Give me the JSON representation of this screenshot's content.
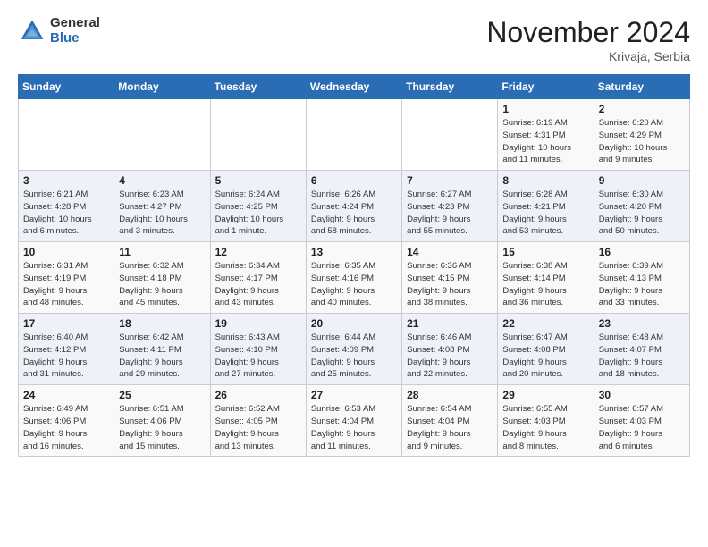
{
  "header": {
    "logo_general": "General",
    "logo_blue": "Blue",
    "month_title": "November 2024",
    "location": "Krivaja, Serbia"
  },
  "days_of_week": [
    "Sunday",
    "Monday",
    "Tuesday",
    "Wednesday",
    "Thursday",
    "Friday",
    "Saturday"
  ],
  "weeks": [
    [
      {
        "day": "",
        "info": ""
      },
      {
        "day": "",
        "info": ""
      },
      {
        "day": "",
        "info": ""
      },
      {
        "day": "",
        "info": ""
      },
      {
        "day": "",
        "info": ""
      },
      {
        "day": "1",
        "info": "Sunrise: 6:19 AM\nSunset: 4:31 PM\nDaylight: 10 hours\nand 11 minutes."
      },
      {
        "day": "2",
        "info": "Sunrise: 6:20 AM\nSunset: 4:29 PM\nDaylight: 10 hours\nand 9 minutes."
      }
    ],
    [
      {
        "day": "3",
        "info": "Sunrise: 6:21 AM\nSunset: 4:28 PM\nDaylight: 10 hours\nand 6 minutes."
      },
      {
        "day": "4",
        "info": "Sunrise: 6:23 AM\nSunset: 4:27 PM\nDaylight: 10 hours\nand 3 minutes."
      },
      {
        "day": "5",
        "info": "Sunrise: 6:24 AM\nSunset: 4:25 PM\nDaylight: 10 hours\nand 1 minute."
      },
      {
        "day": "6",
        "info": "Sunrise: 6:26 AM\nSunset: 4:24 PM\nDaylight: 9 hours\nand 58 minutes."
      },
      {
        "day": "7",
        "info": "Sunrise: 6:27 AM\nSunset: 4:23 PM\nDaylight: 9 hours\nand 55 minutes."
      },
      {
        "day": "8",
        "info": "Sunrise: 6:28 AM\nSunset: 4:21 PM\nDaylight: 9 hours\nand 53 minutes."
      },
      {
        "day": "9",
        "info": "Sunrise: 6:30 AM\nSunset: 4:20 PM\nDaylight: 9 hours\nand 50 minutes."
      }
    ],
    [
      {
        "day": "10",
        "info": "Sunrise: 6:31 AM\nSunset: 4:19 PM\nDaylight: 9 hours\nand 48 minutes."
      },
      {
        "day": "11",
        "info": "Sunrise: 6:32 AM\nSunset: 4:18 PM\nDaylight: 9 hours\nand 45 minutes."
      },
      {
        "day": "12",
        "info": "Sunrise: 6:34 AM\nSunset: 4:17 PM\nDaylight: 9 hours\nand 43 minutes."
      },
      {
        "day": "13",
        "info": "Sunrise: 6:35 AM\nSunset: 4:16 PM\nDaylight: 9 hours\nand 40 minutes."
      },
      {
        "day": "14",
        "info": "Sunrise: 6:36 AM\nSunset: 4:15 PM\nDaylight: 9 hours\nand 38 minutes."
      },
      {
        "day": "15",
        "info": "Sunrise: 6:38 AM\nSunset: 4:14 PM\nDaylight: 9 hours\nand 36 minutes."
      },
      {
        "day": "16",
        "info": "Sunrise: 6:39 AM\nSunset: 4:13 PM\nDaylight: 9 hours\nand 33 minutes."
      }
    ],
    [
      {
        "day": "17",
        "info": "Sunrise: 6:40 AM\nSunset: 4:12 PM\nDaylight: 9 hours\nand 31 minutes."
      },
      {
        "day": "18",
        "info": "Sunrise: 6:42 AM\nSunset: 4:11 PM\nDaylight: 9 hours\nand 29 minutes."
      },
      {
        "day": "19",
        "info": "Sunrise: 6:43 AM\nSunset: 4:10 PM\nDaylight: 9 hours\nand 27 minutes."
      },
      {
        "day": "20",
        "info": "Sunrise: 6:44 AM\nSunset: 4:09 PM\nDaylight: 9 hours\nand 25 minutes."
      },
      {
        "day": "21",
        "info": "Sunrise: 6:46 AM\nSunset: 4:08 PM\nDaylight: 9 hours\nand 22 minutes."
      },
      {
        "day": "22",
        "info": "Sunrise: 6:47 AM\nSunset: 4:08 PM\nDaylight: 9 hours\nand 20 minutes."
      },
      {
        "day": "23",
        "info": "Sunrise: 6:48 AM\nSunset: 4:07 PM\nDaylight: 9 hours\nand 18 minutes."
      }
    ],
    [
      {
        "day": "24",
        "info": "Sunrise: 6:49 AM\nSunset: 4:06 PM\nDaylight: 9 hours\nand 16 minutes."
      },
      {
        "day": "25",
        "info": "Sunrise: 6:51 AM\nSunset: 4:06 PM\nDaylight: 9 hours\nand 15 minutes."
      },
      {
        "day": "26",
        "info": "Sunrise: 6:52 AM\nSunset: 4:05 PM\nDaylight: 9 hours\nand 13 minutes."
      },
      {
        "day": "27",
        "info": "Sunrise: 6:53 AM\nSunset: 4:04 PM\nDaylight: 9 hours\nand 11 minutes."
      },
      {
        "day": "28",
        "info": "Sunrise: 6:54 AM\nSunset: 4:04 PM\nDaylight: 9 hours\nand 9 minutes."
      },
      {
        "day": "29",
        "info": "Sunrise: 6:55 AM\nSunset: 4:03 PM\nDaylight: 9 hours\nand 8 minutes."
      },
      {
        "day": "30",
        "info": "Sunrise: 6:57 AM\nSunset: 4:03 PM\nDaylight: 9 hours\nand 6 minutes."
      }
    ]
  ]
}
